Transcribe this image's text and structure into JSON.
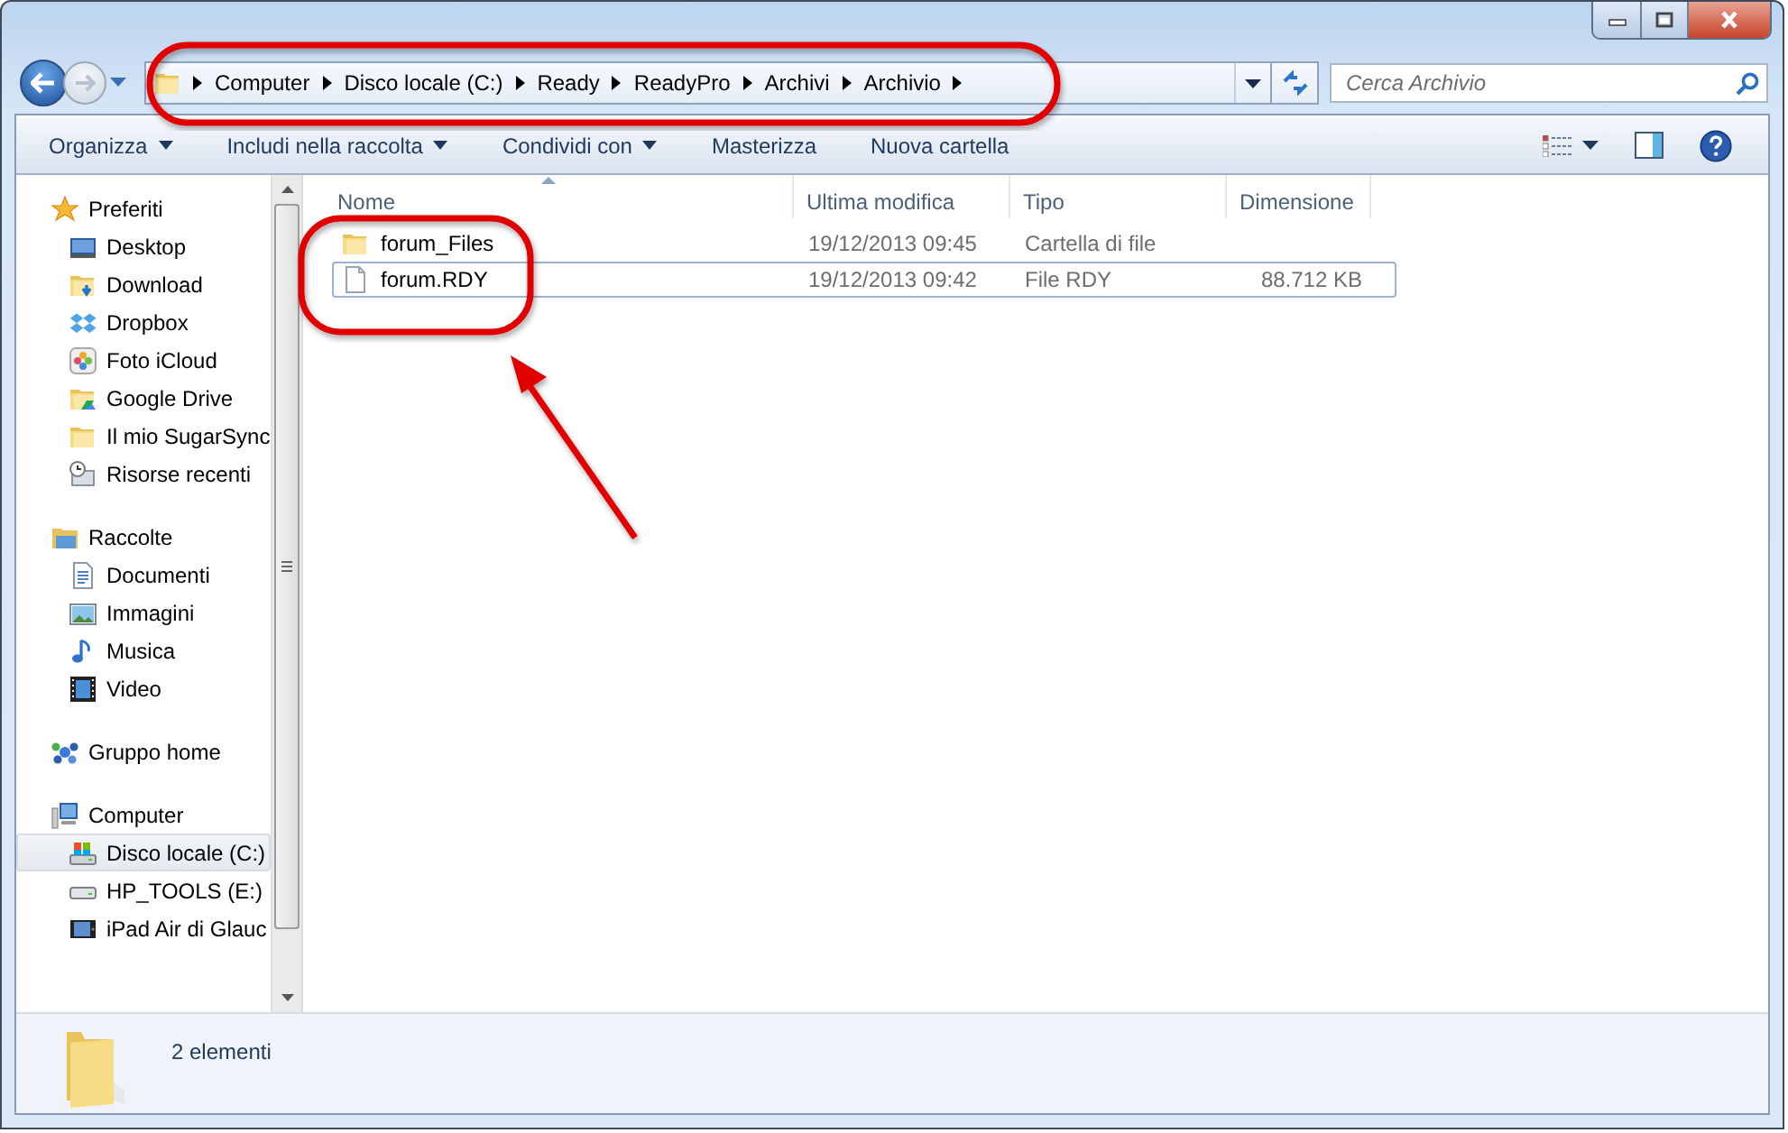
{
  "address_bar": {
    "crumbs": [
      "Computer",
      "Disco locale (C:)",
      "Ready",
      "ReadyPro",
      "Archivi",
      "Archivio"
    ]
  },
  "search": {
    "placeholder": "Cerca Archivio"
  },
  "toolbar": {
    "buttons": [
      {
        "label": "Organizza",
        "dropdown": true
      },
      {
        "label": "Includi nella raccolta",
        "dropdown": true
      },
      {
        "label": "Condividi con",
        "dropdown": true
      },
      {
        "label": "Masterizza",
        "dropdown": false
      },
      {
        "label": "Nuova cartella",
        "dropdown": false
      }
    ]
  },
  "sidebar": {
    "groups": [
      {
        "label": "Preferiti",
        "children": [
          {
            "label": "Desktop",
            "selected": false
          },
          {
            "label": "Download",
            "selected": false
          },
          {
            "label": "Dropbox",
            "selected": false
          },
          {
            "label": "Foto iCloud",
            "selected": false
          },
          {
            "label": "Google Drive",
            "selected": false
          },
          {
            "label": "Il mio SugarSync",
            "selected": false
          },
          {
            "label": "Risorse recenti",
            "selected": false
          }
        ]
      },
      {
        "label": "Raccolte",
        "children": [
          {
            "label": "Documenti",
            "selected": false
          },
          {
            "label": "Immagini",
            "selected": false
          },
          {
            "label": "Musica",
            "selected": false
          },
          {
            "label": "Video",
            "selected": false
          }
        ]
      },
      {
        "label": "Gruppo home"
      },
      {
        "label": "Computer",
        "children": [
          {
            "label": "Disco locale (C:)",
            "selected": true
          },
          {
            "label": "HP_TOOLS (E:)",
            "selected": false
          },
          {
            "label": "iPad Air di Glauc",
            "selected": false
          }
        ]
      }
    ]
  },
  "table": {
    "columns": [
      {
        "label": "Nome",
        "sorted": true
      },
      {
        "label": "Ultima modifica",
        "sorted": false
      },
      {
        "label": "Tipo",
        "sorted": false
      },
      {
        "label": "Dimensione",
        "sorted": false
      }
    ],
    "rows": [
      {
        "kind": "folder",
        "name": "forum_Files",
        "modified": "19/12/2013 09:45",
        "type": "Cartella di file",
        "focused": false
      },
      {
        "kind": "file",
        "name": "forum.RDY",
        "modified": "19/12/2013 09:42",
        "type": "File RDY",
        "size": "88.712 KB",
        "focused": true
      }
    ]
  },
  "status_bar": {
    "text": "2 elementi"
  }
}
